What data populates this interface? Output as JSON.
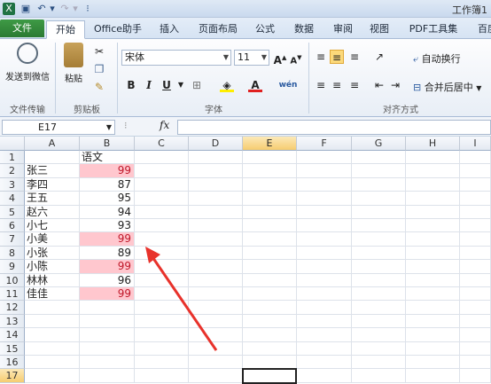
{
  "window": {
    "title": "工作簿1"
  },
  "tabs": [
    {
      "label": "文件",
      "kind": "file"
    },
    {
      "label": "开始",
      "kind": "active"
    },
    {
      "label": "Office助手"
    },
    {
      "label": "插入"
    },
    {
      "label": "页面布局"
    },
    {
      "label": "公式"
    },
    {
      "label": "数据"
    },
    {
      "label": "审阅"
    },
    {
      "label": "视图"
    },
    {
      "label": "PDF工具集"
    },
    {
      "label": "百度"
    }
  ],
  "ribbon": {
    "send_wechat": "发送到微信",
    "paste": "粘贴",
    "font_name": "宋体",
    "font_size": "11",
    "wrap_text": "自动换行",
    "merge_center": "合并后居中",
    "groups": {
      "file_transfer": "文件传输",
      "clipboard": "剪贴板",
      "font": "字体",
      "alignment": "对齐方式"
    }
  },
  "formula_bar": {
    "name_box": "E17",
    "fx": "fx",
    "value": ""
  },
  "columns": [
    "A",
    "B",
    "C",
    "D",
    "E",
    "F",
    "G",
    "H",
    "I"
  ],
  "selected_column": "E",
  "rows": [
    "1",
    "2",
    "3",
    "4",
    "5",
    "6",
    "7",
    "8",
    "9",
    "10",
    "11",
    "12",
    "13",
    "14",
    "15",
    "16",
    "17"
  ],
  "selected_row": "17",
  "cells": [
    {
      "row": 1,
      "a": "",
      "b": "语文",
      "b_type": "txt",
      "hl": false
    },
    {
      "row": 2,
      "a": "张三",
      "b": "99",
      "b_type": "num",
      "hl": true
    },
    {
      "row": 3,
      "a": "李四",
      "b": "87",
      "b_type": "num",
      "hl": false
    },
    {
      "row": 4,
      "a": "王五",
      "b": "95",
      "b_type": "num",
      "hl": false
    },
    {
      "row": 5,
      "a": "赵六",
      "b": "94",
      "b_type": "num",
      "hl": false
    },
    {
      "row": 6,
      "a": "小七",
      "b": "93",
      "b_type": "num",
      "hl": false
    },
    {
      "row": 7,
      "a": "小美",
      "b": "99",
      "b_type": "num",
      "hl": true
    },
    {
      "row": 8,
      "a": "小张",
      "b": "89",
      "b_type": "num",
      "hl": false
    },
    {
      "row": 9,
      "a": "小陈",
      "b": "99",
      "b_type": "num",
      "hl": true
    },
    {
      "row": 10,
      "a": "林林",
      "b": "96",
      "b_type": "num",
      "hl": false
    },
    {
      "row": 11,
      "a": "佳佳",
      "b": "99",
      "b_type": "num",
      "hl": true
    }
  ],
  "colors": {
    "highlight_fill": "#ffc7ce",
    "highlight_text": "#c0182a",
    "arrow": "#e8322b",
    "file_tab": "#2b7a33"
  }
}
